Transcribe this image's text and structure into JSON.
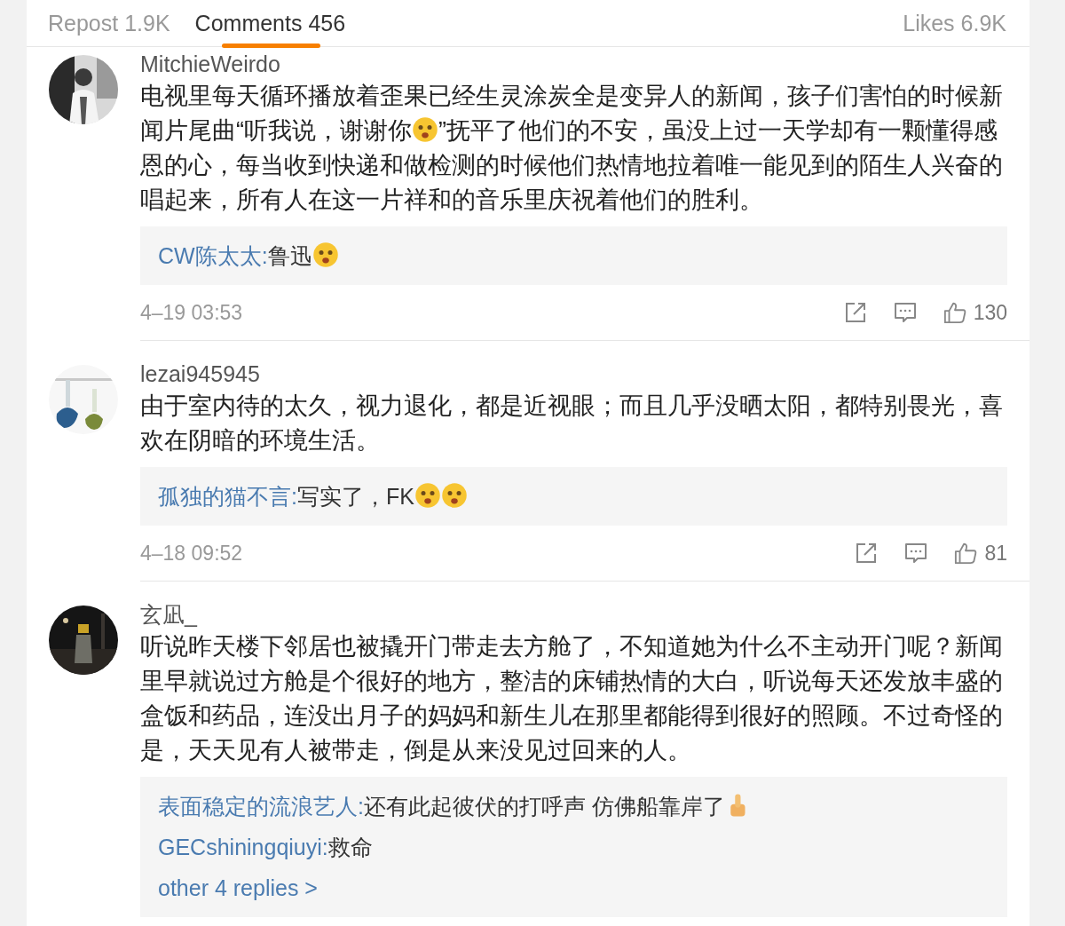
{
  "tabs": [
    {
      "label": "Repost 1.9K",
      "selected": false
    },
    {
      "label": "Comments 456",
      "selected": true
    },
    {
      "label": "Likes 6.9K",
      "selected": false
    }
  ],
  "comments": [
    {
      "username": "MitchieWeirdo",
      "body": [
        {
          "kind": "text",
          "text": "电视里每天循环播放着歪果已经生灵涂炭全是变异人的新闻，孩子们害怕的时候新闻片尾曲“听我说，谢谢你"
        },
        {
          "kind": "face"
        },
        {
          "kind": "text",
          "text": "”抚平了他们的不安，虽没上过一天学却有一颗懂得感恩的心，每当收到快递和做检测的时候他们热情地拉着唯一能见到的陌生人兴奋的唱起来，所有人在这一片祥和的音乐里庆祝着他们的胜利。"
        }
      ],
      "replies": [
        {
          "author": "CW陈太太:",
          "body": [
            {
              "kind": "text",
              "text": "鲁迅"
            },
            {
              "kind": "face"
            }
          ]
        }
      ],
      "time": "4–19 03:53",
      "likes": "130"
    },
    {
      "username": "lezai945945",
      "body": [
        {
          "kind": "text",
          "text": "由于室内待的太久，视力退化，都是近视眼；而且几乎没晒太阳，都特别畏光，喜欢在阴暗的环境生活。"
        }
      ],
      "replies": [
        {
          "author": "孤独的猫不言:",
          "body": [
            {
              "kind": "text",
              "text": "写实了，FK"
            },
            {
              "kind": "face"
            },
            {
              "kind": "face"
            }
          ]
        }
      ],
      "time": "4–18 09:52",
      "likes": "81"
    },
    {
      "username": "玄凪_",
      "body": [
        {
          "kind": "text",
          "text": "听说昨天楼下邻居也被撬开门带走去方舱了，不知道她为什么不主动开门呢？新闻里早就说过方舱是个很好的地方，整洁的床铺热情的大白，听说每天还发放丰盛的盒饭和药品，连没出月子的妈妈和新生儿在那里都能得到很好的照顾。不过奇怪的是，天天见有人被带走，倒是从来没见过回来的人。"
        }
      ],
      "replies": [
        {
          "author": "表面稳定的流浪艺人:",
          "body": [
            {
              "kind": "text",
              "text": "还有此起彼伏的打呼声  仿佛船靠岸了"
            },
            {
              "kind": "thumb"
            }
          ]
        },
        {
          "author": "GECshiningqiuyi:",
          "body": [
            {
              "kind": "text",
              "text": "救命"
            }
          ]
        }
      ],
      "more": "other 4 replies >"
    }
  ]
}
